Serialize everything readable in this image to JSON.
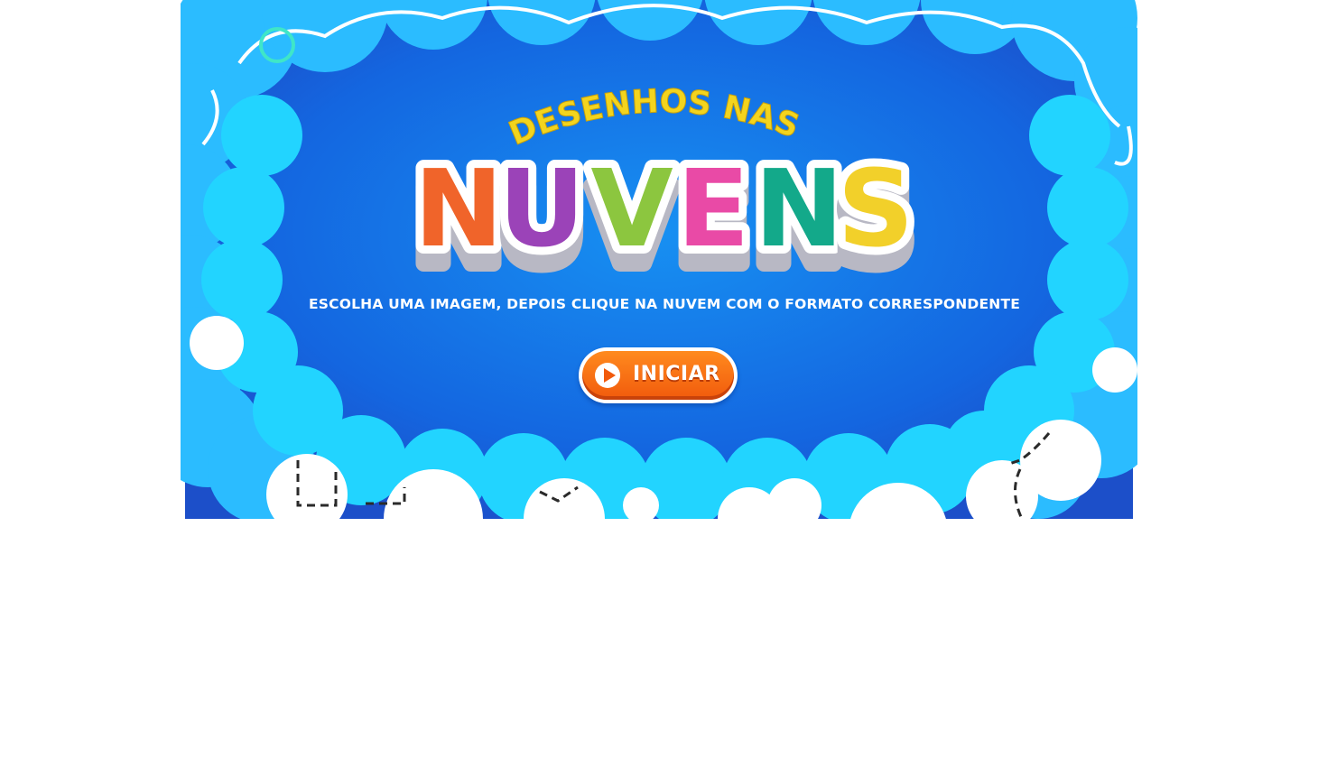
{
  "title": {
    "top_line": "DESENHOS NAS",
    "main_word": "NUVENS",
    "letters": [
      {
        "char": "N",
        "color": "#f0642a"
      },
      {
        "char": "U",
        "color": "#9b43b8"
      },
      {
        "char": "V",
        "color": "#8cc63f"
      },
      {
        "char": "E",
        "color": "#e94aa6"
      },
      {
        "char": "N",
        "color": "#13a98a"
      },
      {
        "char": "S",
        "color": "#f2d02a"
      }
    ]
  },
  "instructions": "ESCOLHA UMA IMAGEM, DEPOIS CLIQUE NA NUVEM COM O FORMATO CORRESPONDENTE",
  "start_button": {
    "label": "INICIAR",
    "icon": "play-icon"
  },
  "colors": {
    "sky_center": "#1580ec",
    "sky_edge": "#1d5fd6",
    "cloud_light": "#2fc8ff",
    "cloud_cyan": "#12e0ff",
    "title_yellow": "#f3d41e",
    "button_orange": "#f26a14"
  }
}
